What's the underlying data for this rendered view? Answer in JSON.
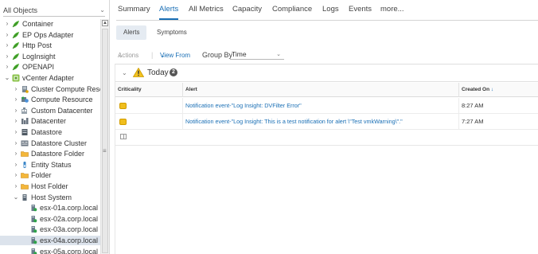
{
  "object_selector": {
    "label": "All Objects"
  },
  "tree": [
    {
      "label": "Container",
      "icon": "adapter-leaf-icon",
      "expanded": false,
      "level": 0,
      "selected": false
    },
    {
      "label": "EP Ops Adapter",
      "icon": "adapter-leaf-icon",
      "expanded": false,
      "level": 0,
      "selected": false
    },
    {
      "label": "Http Post",
      "icon": "adapter-leaf-icon",
      "expanded": false,
      "level": 0,
      "selected": false
    },
    {
      "label": "LogInsight",
      "icon": "adapter-leaf-icon",
      "expanded": false,
      "level": 0,
      "selected": false
    },
    {
      "label": "OPENAPI",
      "icon": "adapter-leaf-icon",
      "expanded": false,
      "level": 0,
      "selected": false
    },
    {
      "label": "vCenter Adapter",
      "icon": "vcenter-adapter-icon",
      "expanded": true,
      "level": 0,
      "selected": false
    },
    {
      "label": "Cluster Compute Resou",
      "icon": "cluster-icon",
      "expanded": false,
      "level": 1,
      "selected": false
    },
    {
      "label": "Compute Resource",
      "icon": "compute-resource-icon",
      "expanded": false,
      "level": 1,
      "selected": false
    },
    {
      "label": "Custom Datacenter",
      "icon": "custom-datacenter-icon",
      "expanded": false,
      "level": 1,
      "selected": false
    },
    {
      "label": "Datacenter",
      "icon": "datacenter-icon",
      "expanded": false,
      "level": 1,
      "selected": false
    },
    {
      "label": "Datastore",
      "icon": "datastore-icon",
      "expanded": false,
      "level": 1,
      "selected": false
    },
    {
      "label": "Datastore Cluster",
      "icon": "datastore-cluster-icon",
      "expanded": false,
      "level": 1,
      "selected": false
    },
    {
      "label": "Datastore Folder",
      "icon": "folder-icon",
      "expanded": false,
      "level": 1,
      "selected": false
    },
    {
      "label": "Entity Status",
      "icon": "entity-status-icon",
      "expanded": false,
      "level": 1,
      "selected": false
    },
    {
      "label": "Folder",
      "icon": "folder-icon",
      "expanded": false,
      "level": 1,
      "selected": false
    },
    {
      "label": "Host Folder",
      "icon": "folder-icon",
      "expanded": false,
      "level": 1,
      "selected": false
    },
    {
      "label": "Host System",
      "icon": "host-system-icon",
      "expanded": true,
      "level": 1,
      "selected": false
    },
    {
      "label": "esx-01a.corp.local",
      "icon": "host-icon",
      "expanded": null,
      "level": 2,
      "selected": false
    },
    {
      "label": "esx-02a.corp.local",
      "icon": "host-icon",
      "expanded": null,
      "level": 2,
      "selected": false
    },
    {
      "label": "esx-03a.corp.local",
      "icon": "host-icon",
      "expanded": null,
      "level": 2,
      "selected": false
    },
    {
      "label": "esx-04a.corp.local",
      "icon": "host-icon",
      "expanded": null,
      "level": 2,
      "selected": true
    },
    {
      "label": "esx-05a.corp.local",
      "icon": "host-icon",
      "expanded": null,
      "level": 2,
      "selected": false
    }
  ],
  "tabs": [
    {
      "label": "Summary",
      "active": false
    },
    {
      "label": "Alerts",
      "active": true
    },
    {
      "label": "All Metrics",
      "active": false
    },
    {
      "label": "Capacity",
      "active": false
    },
    {
      "label": "Compliance",
      "active": false
    },
    {
      "label": "Logs",
      "active": false
    },
    {
      "label": "Events",
      "active": false
    },
    {
      "label": "more...",
      "active": false
    }
  ],
  "subtabs": [
    {
      "label": "Alerts",
      "active": true
    },
    {
      "label": "Symptoms",
      "active": false
    }
  ],
  "toolbar": {
    "actions_label": "Actions",
    "actions_caret": "⌄",
    "separator": "|",
    "view_from_label": "View From",
    "view_from_caret": "⌄",
    "group_by_label": "Group By",
    "group_by_value": "Time",
    "group_by_caret": "⌄"
  },
  "group": {
    "title": "Today",
    "count": "2",
    "chevron": "⌄"
  },
  "columns": {
    "criticality": "Criticality",
    "alert": "Alert",
    "created_on": "Created On",
    "sort_arrow": "↓"
  },
  "rows": [
    {
      "alert": "Notification event-\"Log Insight: DVFilter Error\"",
      "created_on": "8:27 AM",
      "criticality_color": "#f0be1d"
    },
    {
      "alert": "Notification event-\"Log Insight: This is a test notification for alert \\\"Test vmkWarning\\\".\"",
      "created_on": "7:27 AM",
      "criticality_color": "#f0be1d"
    }
  ],
  "colors": {
    "accent": "#1a6fb5",
    "warning": "#f0be1d",
    "selection": "#dce3ec",
    "adapter_green": "#4caf32"
  }
}
